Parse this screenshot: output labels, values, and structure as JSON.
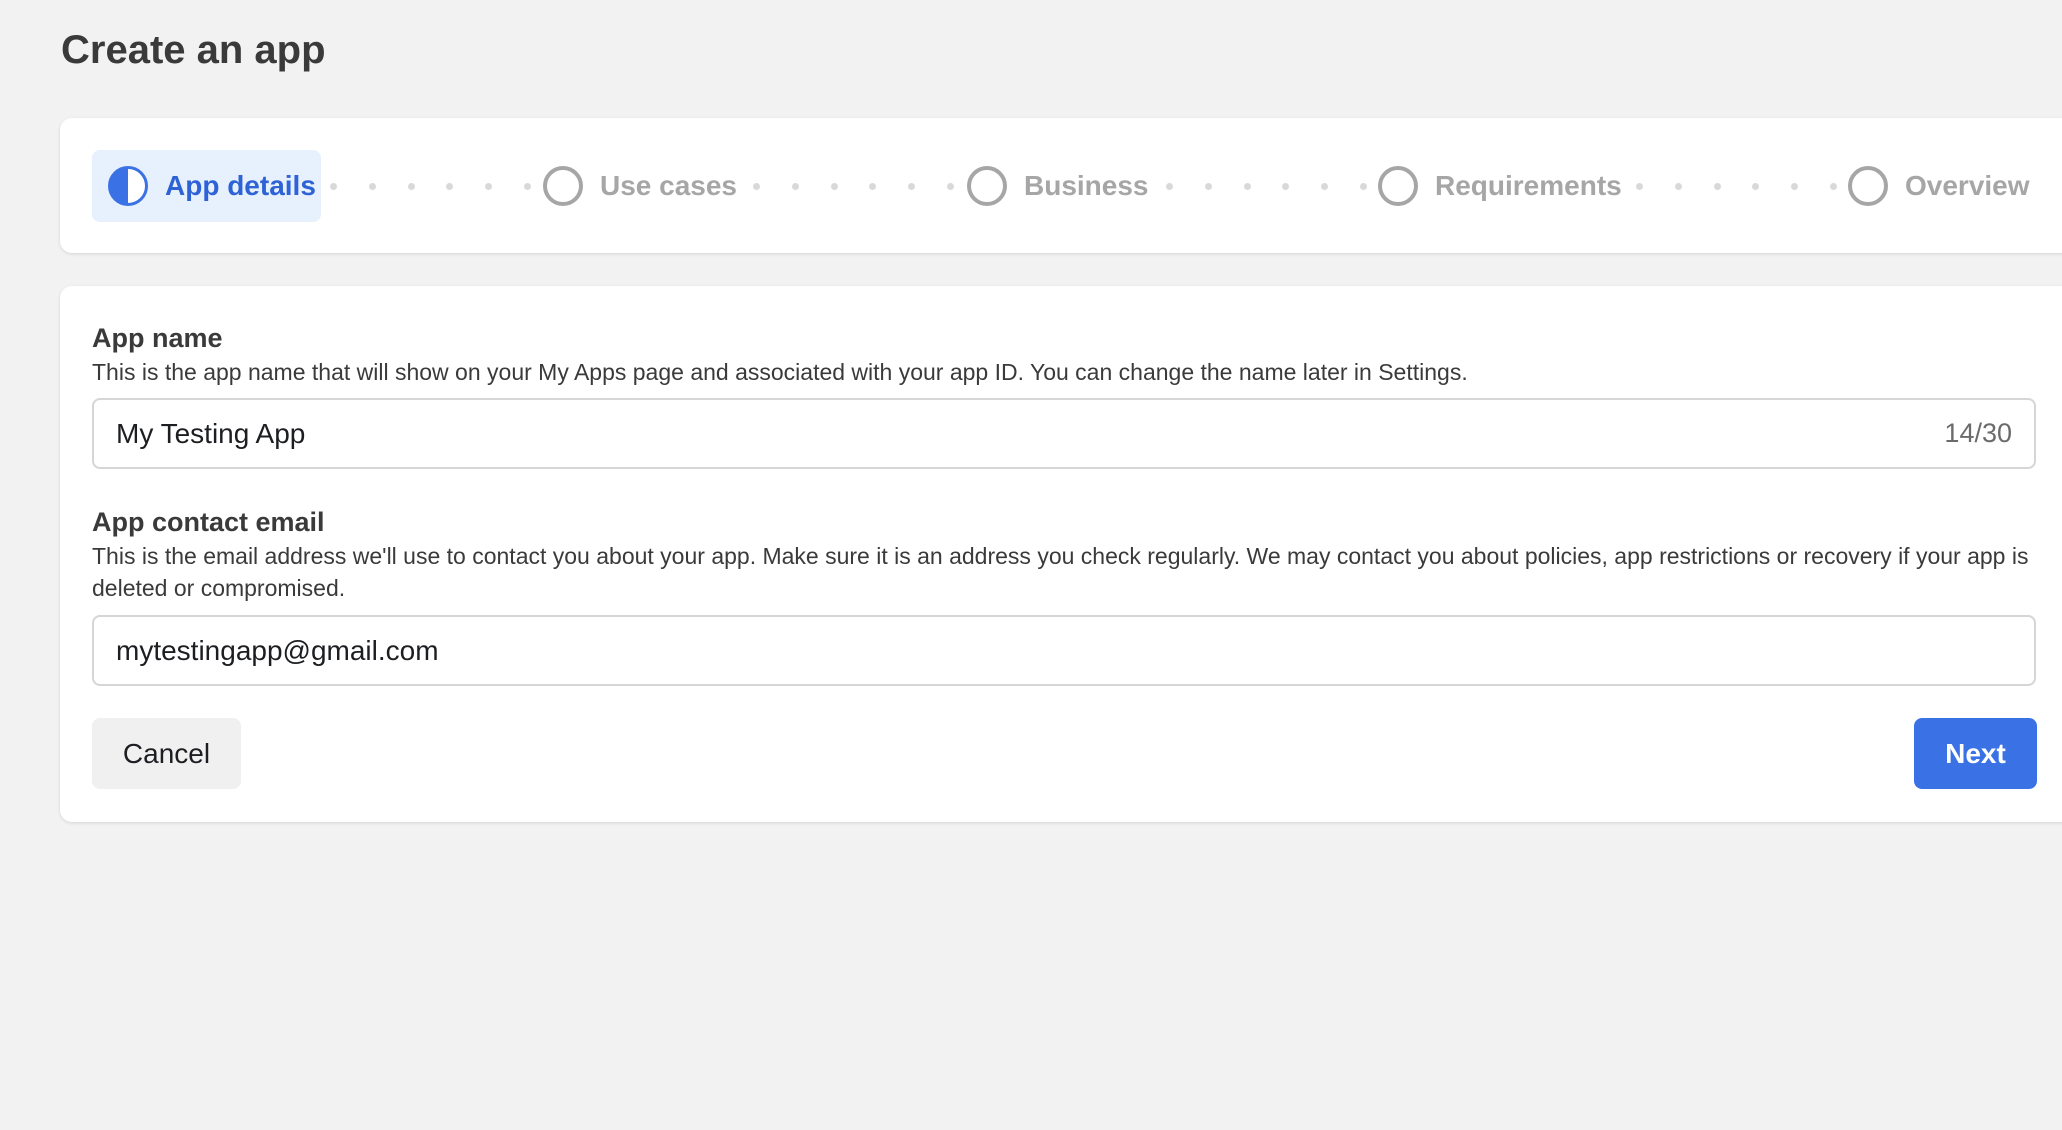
{
  "page": {
    "title": "Create an app"
  },
  "stepper": {
    "steps": [
      {
        "label": "App details",
        "state": "active"
      },
      {
        "label": "Use cases",
        "state": "pending"
      },
      {
        "label": "Business",
        "state": "pending"
      },
      {
        "label": "Requirements",
        "state": "pending"
      },
      {
        "label": "Overview",
        "state": "pending"
      }
    ]
  },
  "form": {
    "app_name": {
      "label": "App name",
      "description": "This is the app name that will show on your My Apps page and associated with your app ID. You can change the name later in Settings.",
      "value": "My Testing App",
      "char_count": "14/30"
    },
    "contact_email": {
      "label": "App contact email",
      "description": "This is the email address we'll use to contact you about your app. Make sure it is an address you check regularly. We may contact you about policies, app restrictions or recovery if your app is deleted or compromised.",
      "value": "mytestingapp@gmail.com"
    },
    "cancel_label": "Cancel",
    "next_label": "Next"
  },
  "colors": {
    "accent": "#3a72e6",
    "active_step_bg": "#e7f0fd",
    "pending_step": "#a6a6a6",
    "page_bg": "#f2f2f2"
  }
}
